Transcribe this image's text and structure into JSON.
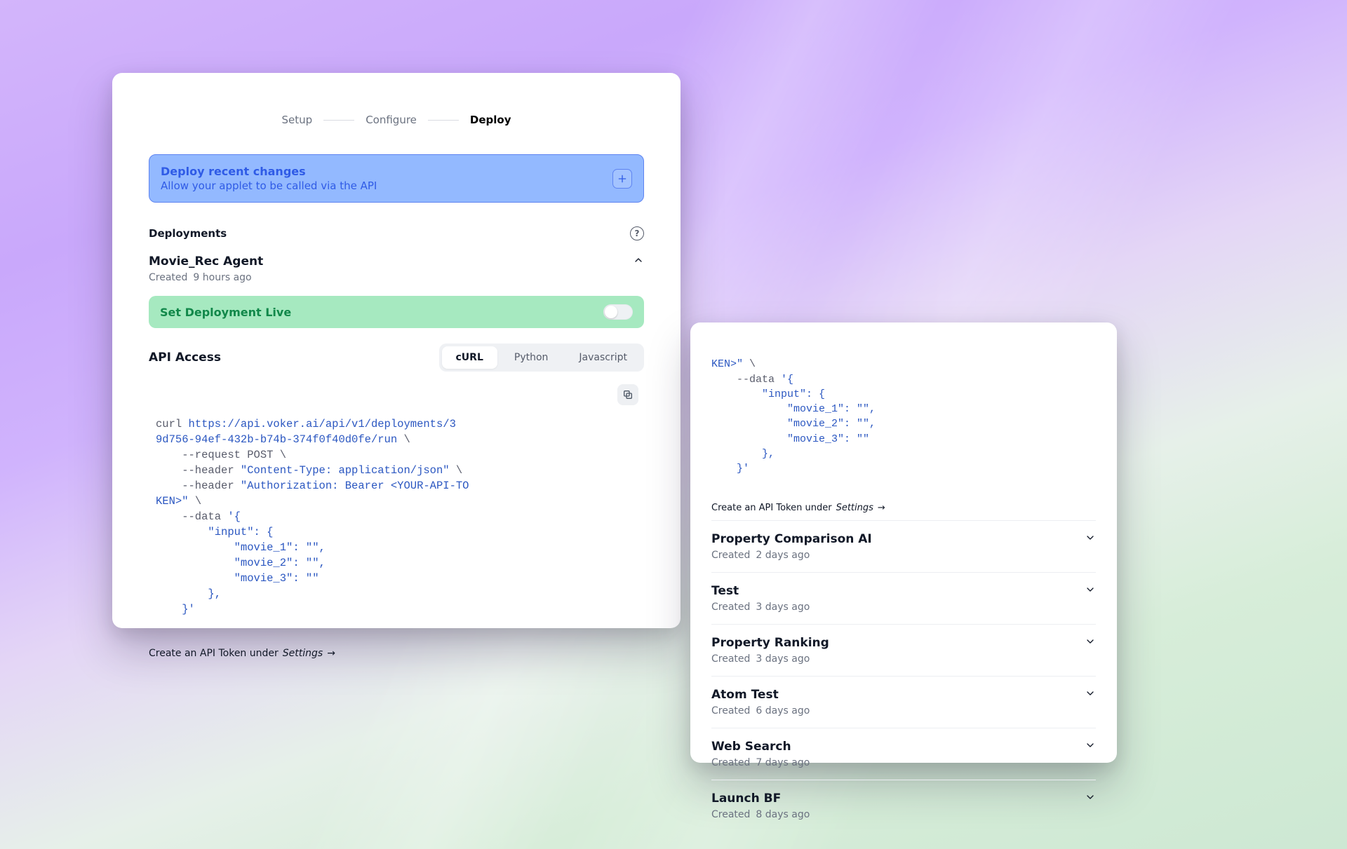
{
  "stepper": {
    "setup": "Setup",
    "configure": "Configure",
    "deploy": "Deploy"
  },
  "banner": {
    "title": "Deploy recent changes",
    "subtitle": "Allow your applet to be called via the API"
  },
  "deployments_heading": "Deployments",
  "active_deployment": {
    "name": "Movie_Rec Agent",
    "created_label": "Created",
    "created_value": "9 hours ago"
  },
  "live": {
    "label": "Set Deployment Live"
  },
  "api": {
    "label": "API Access",
    "tabs": {
      "curl": "cURL",
      "python": "Python",
      "js": "Javascript"
    },
    "code": {
      "l1_pre": "curl ",
      "l1_url1": "https://api.voker.ai/api/v1/deployments/3",
      "l2_url2": "9d756-94ef-432b-b74b-374f0f40d0fe/run",
      "l2_suf": " \\",
      "l3": "    --request POST \\",
      "l4_pre": "    --header ",
      "l4_str": "\"Content-Type: application/json\"",
      "l4_suf": " \\",
      "l5_pre": "    --header ",
      "l5_str": "\"Authorization: Bearer <YOUR-API-TO",
      "l6_pre": "KEN>\"",
      "l6_suf": " \\",
      "l7_pre": "    --data ",
      "l7_str": "'{",
      "l8_str": "        \"input\": {",
      "l9_str": "            \"movie_1\": \"\",",
      "l10_str": "            \"movie_2\": \"\",",
      "l11_str": "            \"movie_3\": \"\"",
      "l12_str": "        },",
      "l13_str": "    }'"
    },
    "hint_pre": "Create an API Token under ",
    "hint_link": "Settings",
    "hint_arrow": "→"
  },
  "right": {
    "code": {
      "l1_pre": "KEN>\"",
      "l1_suf": " \\",
      "l2_pre": "    --data ",
      "l2_str": "'{",
      "l3_str": "        \"input\": {",
      "l4_str": "            \"movie_1\": \"\",",
      "l5_str": "            \"movie_2\": \"\",",
      "l6_str": "            \"movie_3\": \"\"",
      "l7_str": "        },",
      "l8_str": "    }'"
    },
    "hint_pre": "Create an API Token under ",
    "hint_link": "Settings",
    "hint_arrow": "→",
    "items": [
      {
        "name": "Property Comparison AI",
        "created_label": "Created",
        "created_value": "2 days ago"
      },
      {
        "name": "Test",
        "created_label": "Created",
        "created_value": "3 days ago"
      },
      {
        "name": "Property Ranking",
        "created_label": "Created",
        "created_value": "3 days ago"
      },
      {
        "name": "Atom Test",
        "created_label": "Created",
        "created_value": "6 days ago"
      },
      {
        "name": "Web Search",
        "created_label": "Created",
        "created_value": "7 days ago"
      },
      {
        "name": "Launch BF",
        "created_label": "Created",
        "created_value": "8 days ago"
      }
    ]
  }
}
